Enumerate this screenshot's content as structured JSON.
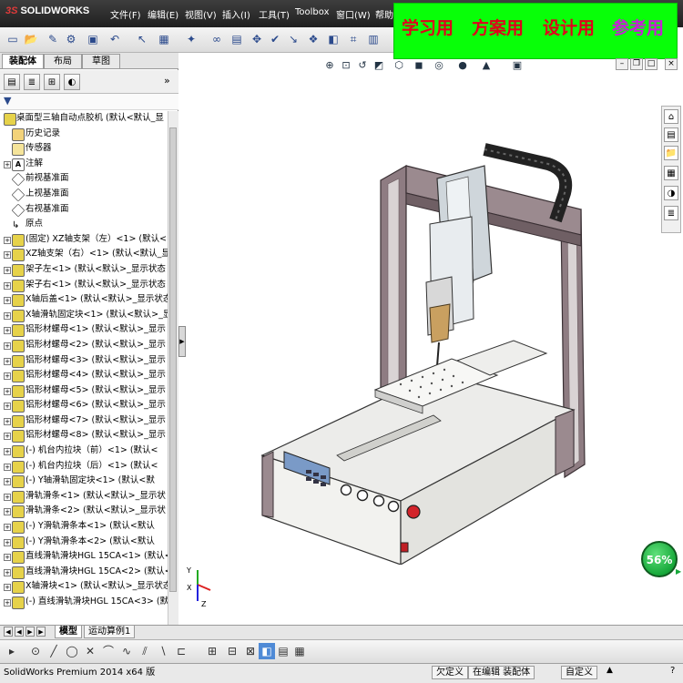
{
  "app": {
    "logo_text": "SOLIDWORKS",
    "logo_mark": "3S"
  },
  "menu": [
    "文件(F)",
    "编辑(E)",
    "视图(V)",
    "插入(I)",
    "工具(T)",
    "Toolbox",
    "窗口(W)",
    "帮助"
  ],
  "promo": {
    "bg": "#08ff08",
    "items": [
      {
        "text": "学习用",
        "color": "#e0001b"
      },
      {
        "text": "方案用",
        "color": "#e0001b"
      },
      {
        "text": "设计用",
        "color": "#e0001b"
      },
      {
        "text": "参考用",
        "color": "#c71fd6"
      }
    ]
  },
  "panel": {
    "tabs": [
      "装配体",
      "布局",
      "草图"
    ],
    "more": "»",
    "tree": [
      {
        "label": "桌面型三轴自动点胶机   (默认<默认_显",
        "kind": "assembly",
        "top": true
      },
      {
        "label": "历史记录",
        "kind": "folder"
      },
      {
        "label": "传感器",
        "kind": "sensor"
      },
      {
        "label": "注解",
        "kind": "note",
        "expand": true
      },
      {
        "label": "前视基准面",
        "kind": "plane"
      },
      {
        "label": "上视基准面",
        "kind": "plane"
      },
      {
        "label": "右视基准面",
        "kind": "plane"
      },
      {
        "label": "原点",
        "kind": "origin"
      },
      {
        "label": "(固定) XZ轴支架（左）<1> (默认<",
        "kind": "part",
        "expand": true
      },
      {
        "label": "XZ轴支架（右）<1> (默认<默认_显",
        "kind": "part",
        "expand": true
      },
      {
        "label": "架子左<1> (默认<默认>_显示状态",
        "kind": "part",
        "expand": true
      },
      {
        "label": "架子右<1> (默认<默认>_显示状态",
        "kind": "part",
        "expand": true
      },
      {
        "label": "X轴后盖<1> (默认<默认>_显示状态",
        "kind": "part",
        "expand": true
      },
      {
        "label": "X轴滑轨固定块<1> (默认<默认>_显",
        "kind": "part",
        "expand": true
      },
      {
        "label": "铝形材螺母<1> (默认<默认>_显示",
        "kind": "part",
        "expand": true
      },
      {
        "label": "铝形材螺母<2> (默认<默认>_显示",
        "kind": "part",
        "expand": true
      },
      {
        "label": "铝形材螺母<3> (默认<默认>_显示",
        "kind": "part",
        "expand": true
      },
      {
        "label": "铝形材螺母<4> (默认<默认>_显示",
        "kind": "part",
        "expand": true
      },
      {
        "label": "铝形材螺母<5> (默认<默认>_显示",
        "kind": "part",
        "expand": true
      },
      {
        "label": "铝形材螺母<6> (默认<默认>_显示",
        "kind": "part",
        "expand": true
      },
      {
        "label": "铝形材螺母<7> (默认<默认>_显示",
        "kind": "part",
        "expand": true
      },
      {
        "label": "铝形材螺母<8> (默认<默认>_显示",
        "kind": "part",
        "expand": true
      },
      {
        "label": "(-) 机台内拉块（前）<1> (默认<",
        "kind": "part",
        "expand": true
      },
      {
        "label": "(-) 机台内拉块（后）<1> (默认<",
        "kind": "part",
        "expand": true
      },
      {
        "label": "(-) Y轴滑轨固定块<1> (默认<默",
        "kind": "part",
        "expand": true
      },
      {
        "label": "滑轨滑条<1> (默认<默认>_显示状",
        "kind": "part",
        "expand": true
      },
      {
        "label": "滑轨滑条<2> (默认<默认>_显示状",
        "kind": "part",
        "expand": true
      },
      {
        "label": "(-) Y滑轨滑条本<1> (默认<默认",
        "kind": "part",
        "expand": true
      },
      {
        "label": "(-) Y滑轨滑条本<2> (默认<默认",
        "kind": "part",
        "expand": true
      },
      {
        "label": "直线滑轨滑块HGL 15CA<1> (默认<",
        "kind": "part",
        "expand": true
      },
      {
        "label": "直线滑轨滑块HGL 15CA<2> (默认<",
        "kind": "part",
        "expand": true
      },
      {
        "label": "X轴滑块<1> (默认<默认>_显示状态",
        "kind": "part",
        "expand": true
      },
      {
        "label": "(-) 直线滑轨滑块HGL 15CA<3> (默",
        "kind": "part",
        "expand": true
      }
    ]
  },
  "graphics": {
    "gauge_value": "56%",
    "triad": {
      "y": "Y",
      "x": "X",
      "z": "Z"
    }
  },
  "bottom_tabs": [
    "模型",
    "运动算例1"
  ],
  "status": {
    "product": "SolidWorks Premium 2014 x64 版",
    "constraint": "欠定义",
    "editing": "在编辑 装配体",
    "custom": "自定义"
  },
  "colors": {
    "frame": "#9a8a8c",
    "base": "#eaeae4",
    "panel_blue": "#7a9ac7",
    "drag_chain": "#2a2a2a"
  }
}
